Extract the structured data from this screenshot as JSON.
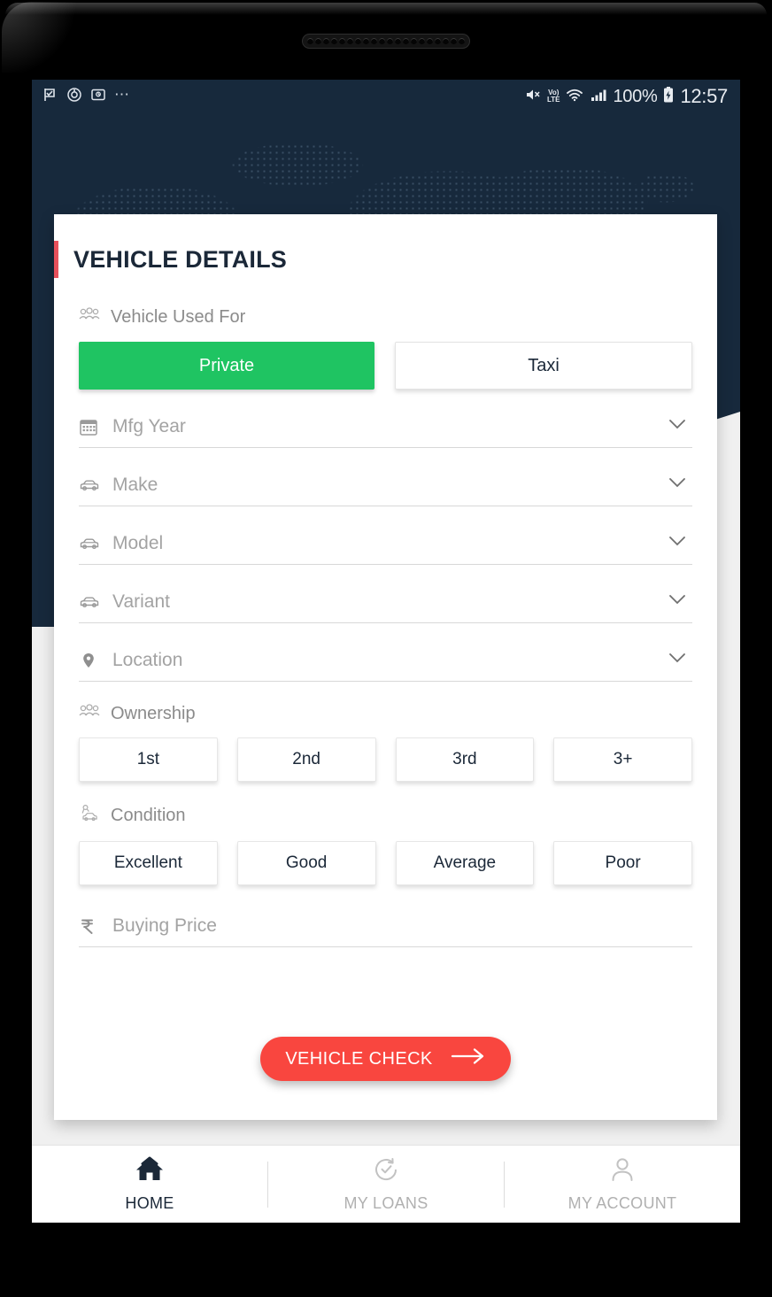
{
  "status_bar": {
    "left_icons": [
      "flag-check-icon",
      "clock-alarm-icon",
      "screenshot-icon",
      "more-dots-icon"
    ],
    "right_icons": [
      "mute-vibrate-icon",
      "volte-icon",
      "wifi-icon",
      "signal-bars-icon",
      "battery-charging-icon"
    ],
    "volte_top": "Vo)",
    "volte_bottom": "LTE",
    "battery_percent": "100%",
    "clock": "12:57"
  },
  "card": {
    "title": "VEHICLE DETAILS",
    "accent_color": "#e8505b"
  },
  "vehicle_used_for": {
    "label": "Vehicle Used For",
    "icon": "people-group-icon",
    "options": [
      {
        "label": "Private",
        "selected": true
      },
      {
        "label": "Taxi",
        "selected": false
      }
    ],
    "selected_color": "#1fc462"
  },
  "fields": [
    {
      "placeholder": "Mfg Year",
      "value": "",
      "icon": "calendar-icon"
    },
    {
      "placeholder": "Make",
      "value": "",
      "icon": "car-icon"
    },
    {
      "placeholder": "Model",
      "value": "",
      "icon": "car-icon"
    },
    {
      "placeholder": "Variant",
      "value": "",
      "icon": "car-icon"
    },
    {
      "placeholder": "Location",
      "value": "",
      "icon": "map-pin-icon"
    }
  ],
  "ownership": {
    "label": "Ownership",
    "icon": "people-group-icon",
    "options": [
      "1st",
      "2nd",
      "3rd",
      "3+"
    ],
    "selected": null
  },
  "condition": {
    "label": "Condition",
    "icon": "car-repair-icon",
    "options": [
      "Excellent",
      "Good",
      "Average",
      "Poor"
    ],
    "selected": null
  },
  "buying_price": {
    "placeholder": "Buying Price",
    "value": "",
    "icon": "rupee-icon"
  },
  "cta": {
    "label": "VEHICLE CHECK",
    "icon": "arrow-right-icon",
    "color": "#f9463f"
  },
  "bottom_nav": [
    {
      "label": "HOME",
      "icon": "home-icon",
      "active": true
    },
    {
      "label": "MY LOANS",
      "icon": "loan-history-icon",
      "active": false
    },
    {
      "label": "MY ACCOUNT",
      "icon": "person-icon",
      "active": false
    }
  ]
}
